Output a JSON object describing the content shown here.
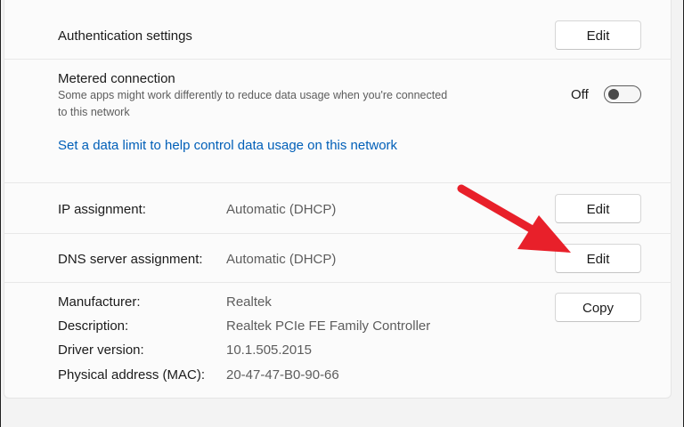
{
  "auth": {
    "label": "Authentication settings",
    "button": "Edit"
  },
  "metered": {
    "title": "Metered connection",
    "desc": "Some apps might work differently to reduce data usage when you're connected to this network",
    "state": "Off",
    "on": false
  },
  "data_limit_link": "Set a data limit to help control data usage on this network",
  "ip": {
    "label": "IP assignment:",
    "value": "Automatic (DHCP)",
    "button": "Edit"
  },
  "dns": {
    "label": "DNS server assignment:",
    "value": "Automatic (DHCP)",
    "button": "Edit"
  },
  "properties": {
    "button": "Copy",
    "rows": [
      {
        "label": "Manufacturer:",
        "value": "Realtek"
      },
      {
        "label": "Description:",
        "value": "Realtek PCIe FE Family Controller"
      },
      {
        "label": "Driver version:",
        "value": "10.1.505.2015"
      },
      {
        "label": "Physical address (MAC):",
        "value": "20-47-47-B0-90-66"
      }
    ]
  },
  "annotation": {
    "arrow_color": "#e8202a"
  }
}
